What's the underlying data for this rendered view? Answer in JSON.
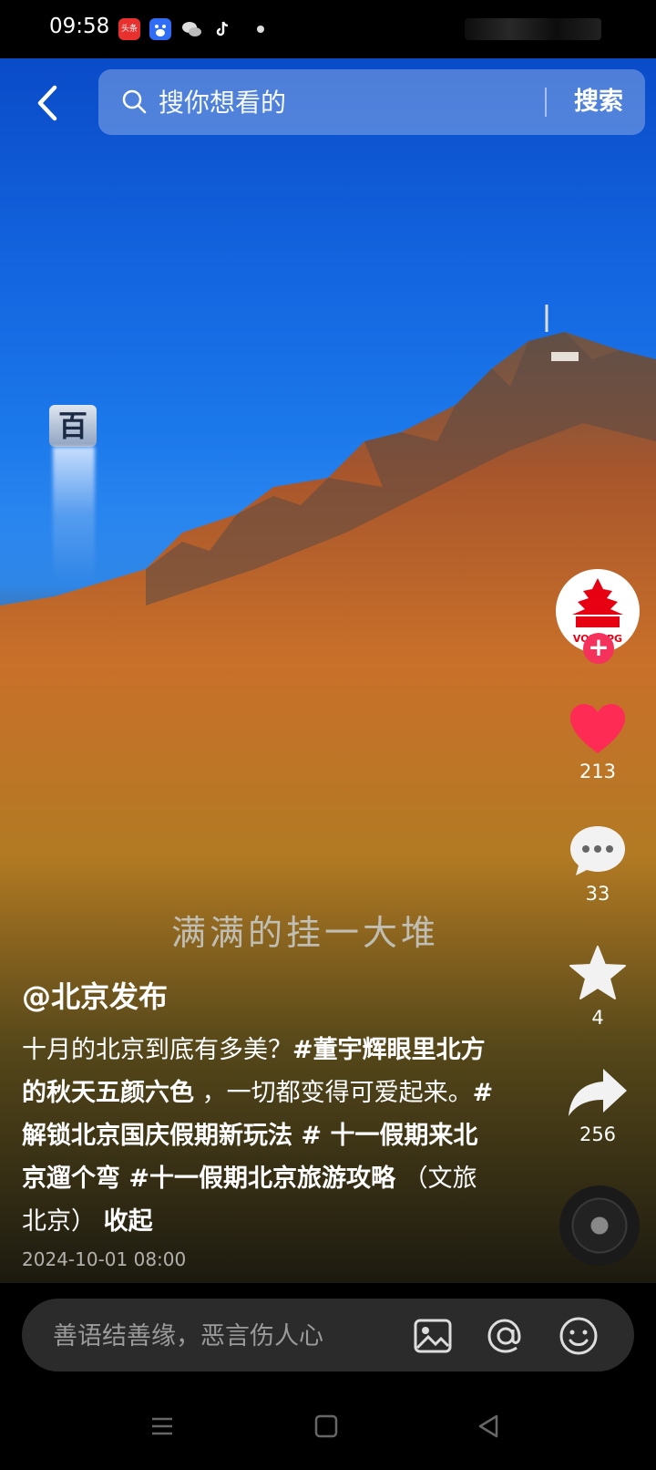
{
  "status_bar": {
    "time": "09:58",
    "app_icons": [
      {
        "name": "toutiao-icon",
        "label": "头条",
        "color": "#e8312f"
      },
      {
        "name": "baidu-icon",
        "label": "",
        "color": "#2f6df6"
      },
      {
        "name": "wechat-icon",
        "label": "",
        "color": "#3a3a3a"
      },
      {
        "name": "tiktok-icon",
        "label": "",
        "color": "#111111"
      }
    ]
  },
  "header": {
    "search_placeholder": "搜你想看的",
    "search_button": "搜索"
  },
  "video": {
    "watermark_char": "百",
    "overlay_subtitle": "满满的挂一大堆"
  },
  "side_rail": {
    "avatar_text": "VORMPG",
    "follow_label": "+",
    "likes": "213",
    "comments": "33",
    "favorites": "4",
    "shares": "256",
    "like_color": "#fe2c55"
  },
  "post": {
    "author": "@北京发布",
    "caption_plain_1": "十月的北京到底有多美？",
    "tag_1": "#董宇辉眼里北方的秋天五颜六色",
    "caption_plain_2": " ，一切都变得可爱起来。",
    "tag_2": "#解锁北京国庆假期新玩法",
    "tag_sep": " # ",
    "tag_3": "十一假期来北京遛个弯",
    "tag_4": " #十一假期北京旅游攻略",
    "source": " （文旅北京） ",
    "collapse": " 收起",
    "timestamp": "2024-10-01 08:00"
  },
  "comment_bar": {
    "placeholder": "善语结善缘，恶言伤人心"
  }
}
